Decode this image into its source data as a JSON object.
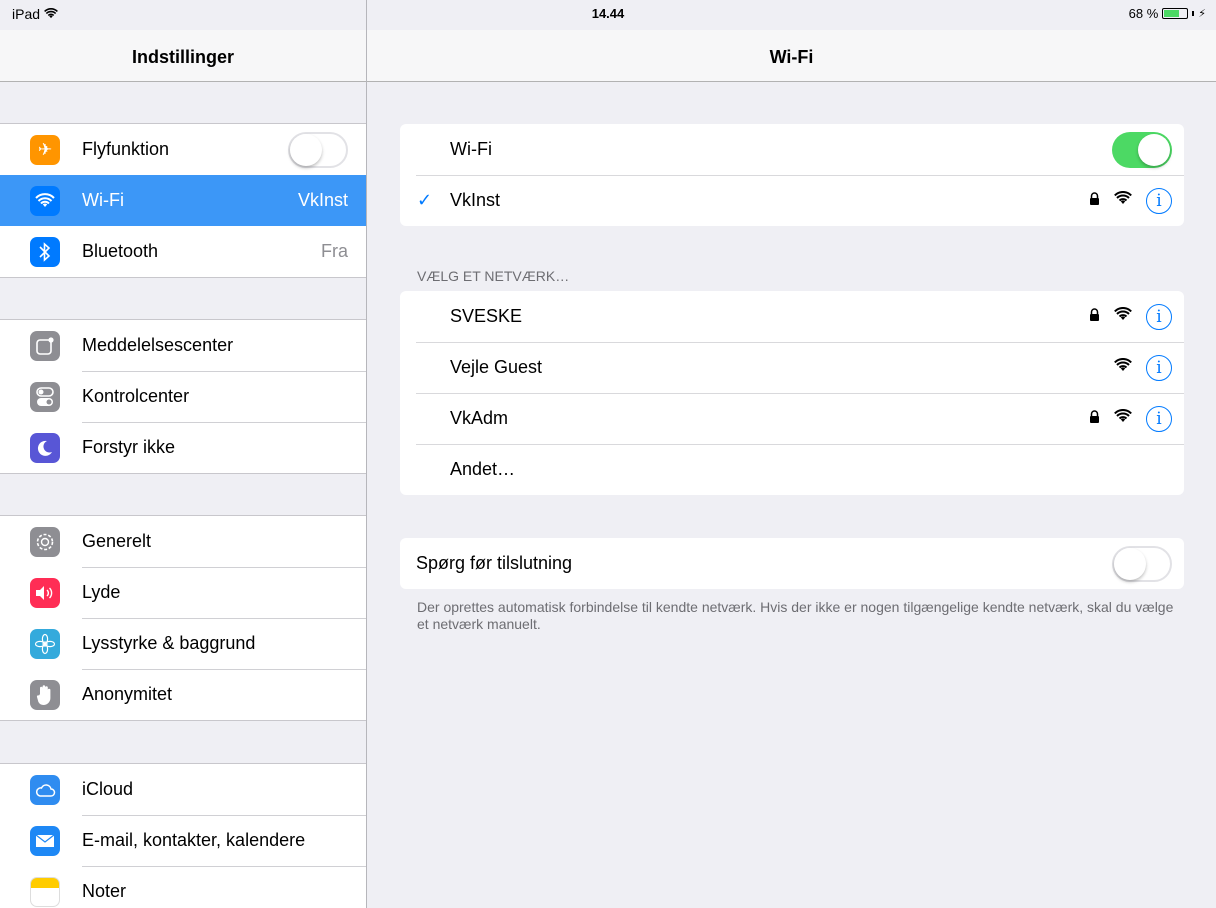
{
  "status_bar": {
    "device": "iPad",
    "time": "14.44",
    "battery_percent": "68 %",
    "battery_level": 0.68
  },
  "sidebar": {
    "title": "Indstillinger",
    "groups": [
      {
        "items": [
          {
            "label": "Flyfunktion",
            "icon": "airplane-icon",
            "color": "#ff9500",
            "toggle": false
          },
          {
            "label": "Wi-Fi",
            "icon": "wifi-icon",
            "color": "#007aff",
            "value": "VkInst",
            "selected": true
          },
          {
            "label": "Bluetooth",
            "icon": "bluetooth-icon",
            "color": "#007aff",
            "value": "Fra"
          }
        ]
      },
      {
        "items": [
          {
            "label": "Meddelelsescenter",
            "icon": "notification-center-icon",
            "color": "#8e8e93"
          },
          {
            "label": "Kontrolcenter",
            "icon": "control-center-icon",
            "color": "#8e8e93"
          },
          {
            "label": "Forstyr ikke",
            "icon": "moon-icon",
            "color": "#5856d6"
          }
        ]
      },
      {
        "items": [
          {
            "label": "Generelt",
            "icon": "gear-icon",
            "color": "#8e8e93"
          },
          {
            "label": "Lyde",
            "icon": "speaker-icon",
            "color": "#ff2d55"
          },
          {
            "label": "Lysstyrke & baggrund",
            "icon": "flower-icon",
            "color": "#34aadc"
          },
          {
            "label": "Anonymitet",
            "icon": "hand-icon",
            "color": "#8e8e93"
          }
        ]
      },
      {
        "items": [
          {
            "label": "iCloud",
            "icon": "cloud-icon",
            "color": "#2f8cf0"
          },
          {
            "label": "E-mail, kontakter, kalendere",
            "icon": "mail-icon",
            "color": "#1e88f5"
          },
          {
            "label": "Noter",
            "icon": "notes-icon",
            "color": "#ffcc00"
          }
        ]
      }
    ]
  },
  "main": {
    "title": "Wi-Fi",
    "wifi_toggle_label": "Wi-Fi",
    "wifi_enabled": true,
    "connected_network": "VkInst",
    "section_title": "VÆLG ET NETVÆRK…",
    "networks": [
      {
        "name": "SVESKE",
        "locked": true
      },
      {
        "name": "Vejle Guest",
        "locked": false
      },
      {
        "name": "VkAdm",
        "locked": true
      }
    ],
    "other_label": "Andet…",
    "ask_label": "Spørg før tilslutning",
    "ask_enabled": false,
    "footer": "Der oprettes automatisk forbindelse til kendte netværk. Hvis der ikke er nogen tilgængelige kendte netværk, skal du vælge et netværk manuelt."
  }
}
